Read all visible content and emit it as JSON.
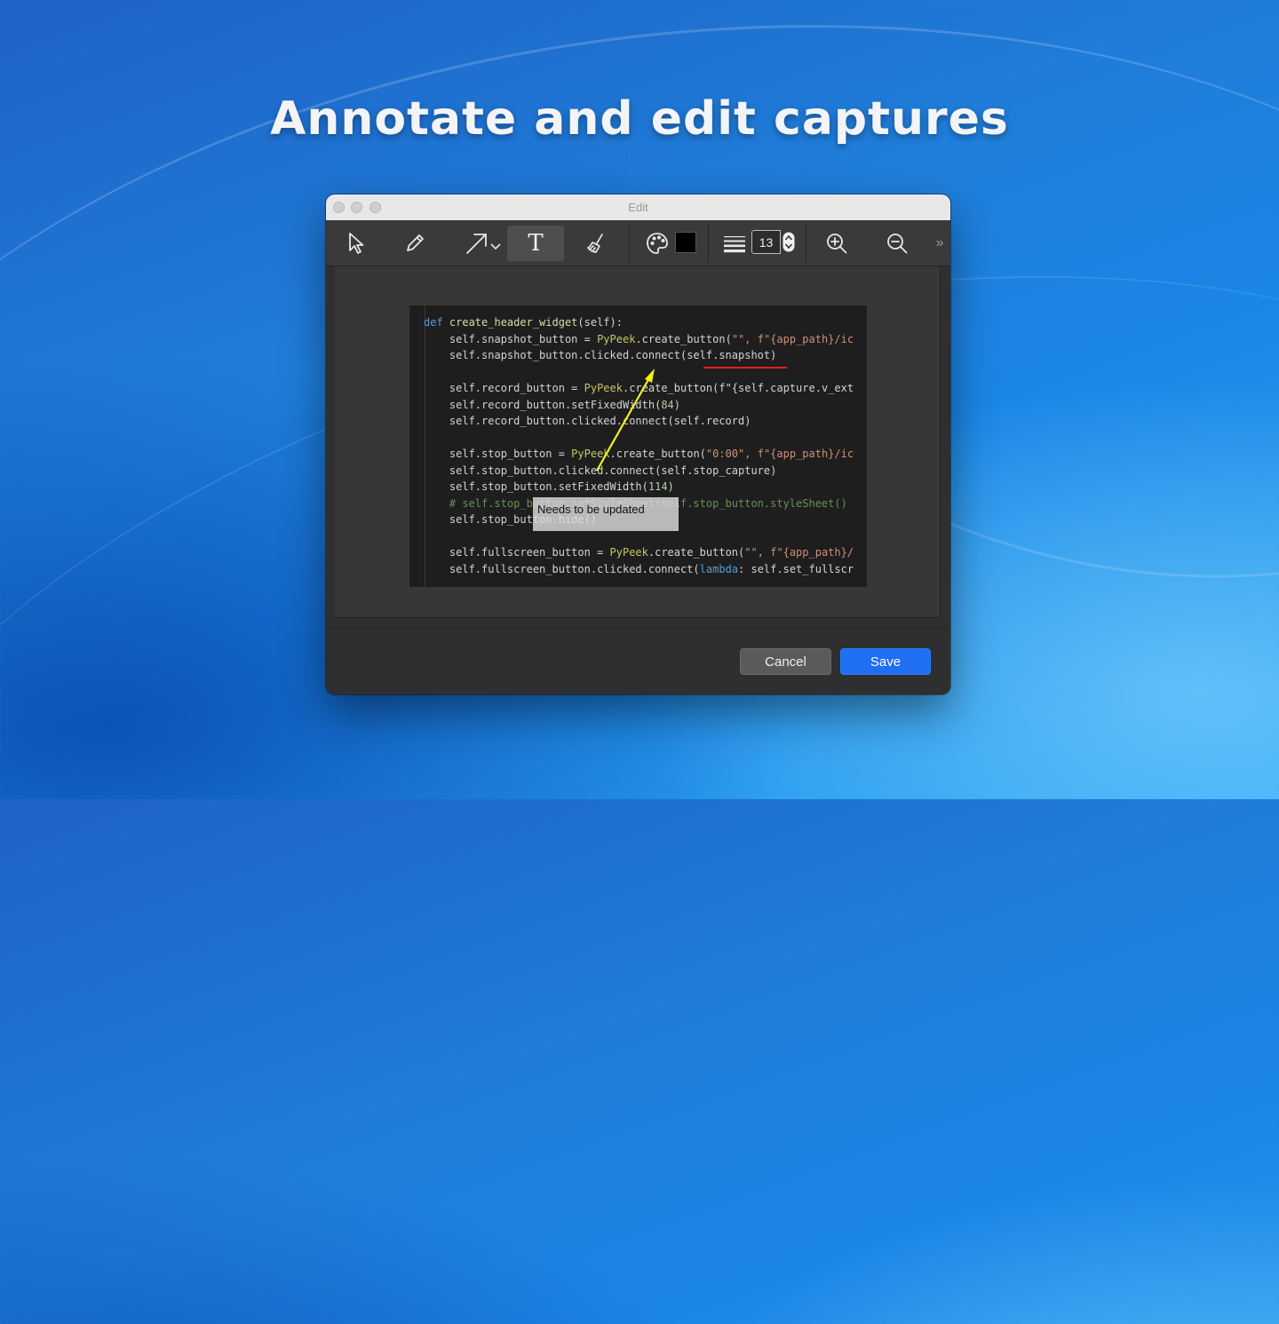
{
  "headline": "Annotate and edit captures",
  "window": {
    "title": "Edit",
    "toolbar": {
      "tools": [
        "pointer-icon",
        "pencil-icon",
        "arrow-icon",
        "text-icon",
        "eraser-icon",
        "palette-icon",
        "line-width-icon",
        "zoom-in-icon",
        "zoom-out-icon",
        "more-icon"
      ],
      "text_tool_label": "T",
      "active_tool": "text",
      "color": "#000000",
      "font_size": "13",
      "overflow_label": "»"
    },
    "capture": {
      "code_lines": [
        [
          {
            "t": "def ",
            "c": "kw"
          },
          {
            "t": "create_header_widget",
            "c": "fn"
          },
          {
            "t": "(self):",
            "c": ""
          }
        ],
        [
          {
            "t": "    self.snapshot_button = ",
            "c": ""
          },
          {
            "t": "PyPeek",
            "c": "cl"
          },
          {
            "t": ".create_button(",
            "c": ""
          },
          {
            "t": "\"\"",
            "c": "str"
          },
          {
            "t": ", f\"{app_path}/ic",
            "c": "str"
          }
        ],
        [
          {
            "t": "    self.snapshot_button.clicked.connect(self.snapshot)",
            "c": ""
          }
        ],
        [
          {
            "t": "",
            "c": ""
          }
        ],
        [
          {
            "t": "    self.record_button = ",
            "c": ""
          },
          {
            "t": "PyPeek",
            "c": "cl"
          },
          {
            "t": ".create_button(f\"{self.capture.v_ext",
            "c": ""
          }
        ],
        [
          {
            "t": "    self.record_button.setFixedWidth(",
            "c": ""
          },
          {
            "t": "84",
            "c": "nm"
          },
          {
            "t": ")",
            "c": ""
          }
        ],
        [
          {
            "t": "    self.record_button.clicked.connect(self.record)",
            "c": ""
          }
        ],
        [
          {
            "t": "",
            "c": ""
          }
        ],
        [
          {
            "t": "    self.stop_button = ",
            "c": ""
          },
          {
            "t": "PyPeek",
            "c": "cl"
          },
          {
            "t": ".create_button(",
            "c": ""
          },
          {
            "t": "\"0:00\"",
            "c": "str"
          },
          {
            "t": ", f\"{app_path}/ic",
            "c": "str"
          }
        ],
        [
          {
            "t": "    self.stop_button.clicked.connect(self.stop_capture)",
            "c": ""
          }
        ],
        [
          {
            "t": "    self.stop_button.setFixedWidth(",
            "c": ""
          },
          {
            "t": "114",
            "c": "nm"
          },
          {
            "t": ")",
            "c": ""
          }
        ],
        [
          {
            "t": "    # self.stop_button.setStyleSheet(self.stop_button.styleSheet()",
            "c": "cm"
          }
        ],
        [
          {
            "t": "    self.stop_button.hide()",
            "c": ""
          }
        ],
        [
          {
            "t": "",
            "c": ""
          }
        ],
        [
          {
            "t": "    self.fullscreen_button = ",
            "c": ""
          },
          {
            "t": "PyPeek",
            "c": "cl"
          },
          {
            "t": ".create_button(",
            "c": ""
          },
          {
            "t": "\"\"",
            "c": "str"
          },
          {
            "t": ", f\"{app_path}/",
            "c": "str"
          }
        ],
        [
          {
            "t": "    self.fullscreen_button.clicked.connect(",
            "c": ""
          },
          {
            "t": "lambda",
            "c": "kw"
          },
          {
            "t": ": self.set_fullscr",
            "c": ""
          }
        ]
      ],
      "annotation_text": "Needs to be updated",
      "arrow_color": "#f2f21a",
      "underline_color": "#e02020"
    },
    "buttons": {
      "cancel": "Cancel",
      "save": "Save"
    }
  }
}
